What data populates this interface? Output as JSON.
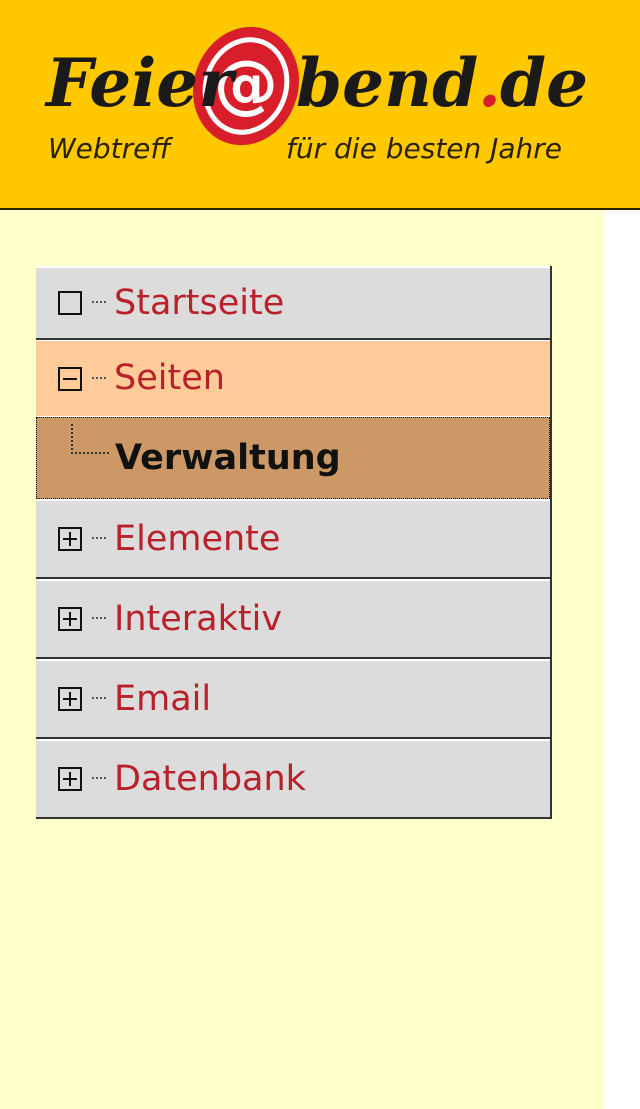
{
  "header": {
    "brand": "Feier@bend.de",
    "tagline_left": "Webtreff",
    "tagline_right": "für die besten Jahre"
  },
  "nav": {
    "items": [
      {
        "label": "Startseite",
        "state": "leaf"
      },
      {
        "label": "Seiten",
        "state": "expanded"
      },
      {
        "label": "Verwaltung",
        "state": "selected-child"
      },
      {
        "label": "Elemente",
        "state": "collapsed"
      },
      {
        "label": "Interaktiv",
        "state": "collapsed"
      },
      {
        "label": "Email",
        "state": "collapsed"
      },
      {
        "label": "Datenbank",
        "state": "collapsed"
      }
    ]
  },
  "colors": {
    "header_bg": "#ffc800",
    "sidebar_bg": "#ffffcc",
    "item_bg": "#dcdcdc",
    "open_bg": "#ffcc99",
    "selected_bg": "#cc9966",
    "link_red": "#b8202a"
  }
}
